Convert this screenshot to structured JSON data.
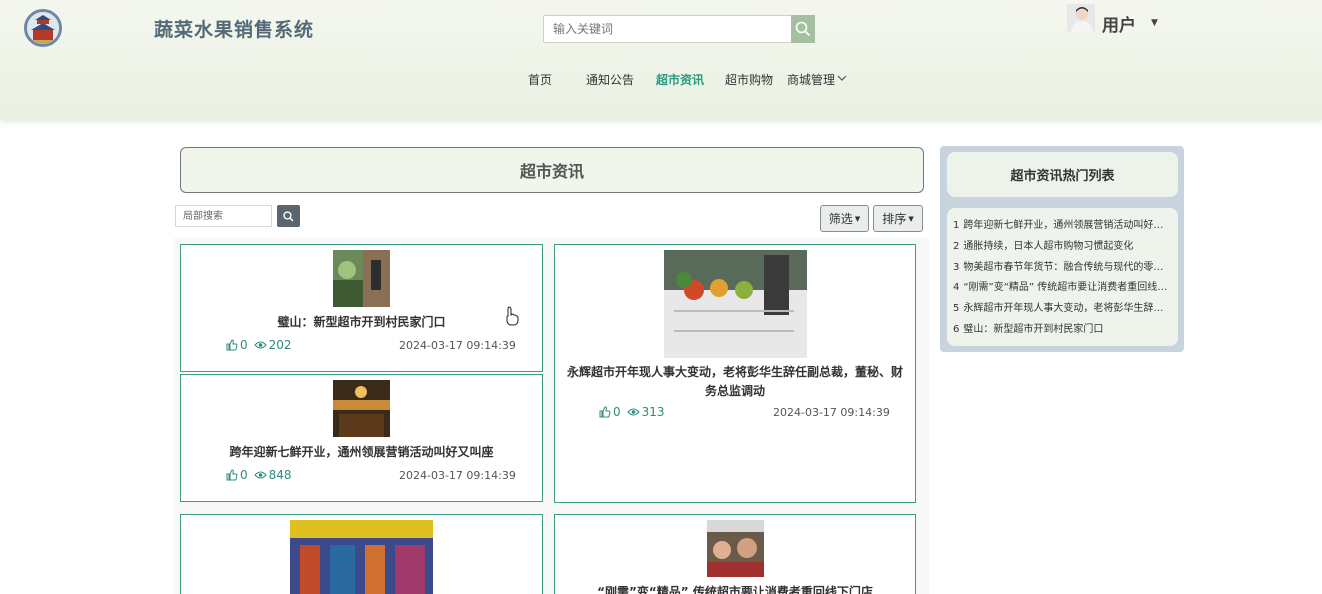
{
  "header": {
    "site_title": "蔬菜水果销售系统",
    "search_placeholder": "输入关键词",
    "user_label": "用户",
    "nav": [
      {
        "label": "首页",
        "active": false
      },
      {
        "label": "通知公告",
        "active": false
      },
      {
        "label": "超市资讯",
        "active": true
      },
      {
        "label": "超市购物",
        "active": false
      },
      {
        "label": "商城管理",
        "active": false,
        "has_dropdown": true
      }
    ],
    "accent_color": "#2a9a80"
  },
  "main": {
    "section_title": "超市资讯",
    "local_search_placeholder": "局部搜索",
    "filter_label": "筛选",
    "sort_label": "排序",
    "articles": [
      {
        "title": "璧山：新型超市开到村民家门口",
        "likes": "0",
        "views": "202",
        "date": "2024-03-17 09:14:39"
      },
      {
        "title": "跨年迎新七鲜开业，通州领展营销活动叫好又叫座",
        "likes": "0",
        "views": "848",
        "date": "2024-03-17 09:14:39"
      },
      {
        "title": "永辉超市开年现人事大变动，老将彭华生辞任副总裁，董秘、财务总监调动",
        "likes": "0",
        "views": "313",
        "date": "2024-03-17 09:14:39"
      },
      {
        "title": "",
        "likes": "",
        "views": "",
        "date": ""
      },
      {
        "title": "“刚需”变“精品” 传统超市要让消费者重回线下门店",
        "likes": "",
        "views": "",
        "date": ""
      }
    ]
  },
  "sidebar": {
    "title": "超市资讯热门列表",
    "items": [
      {
        "rank": "1",
        "text": "跨年迎新七鲜开业，通州领展营销活动叫好又叫座"
      },
      {
        "rank": "2",
        "text": "通胀持续，日本人超市购物习惯起变化"
      },
      {
        "rank": "3",
        "text": "物美超市春节年货节：融合传统与现代的零售新体验"
      },
      {
        "rank": "4",
        "text": "“刚需”变“精品” 传统超市要让消费者重回线下门店"
      },
      {
        "rank": "5",
        "text": "永辉超市开年现人事大变动，老将彭华生辞任副总裁"
      },
      {
        "rank": "6",
        "text": "璧山：新型超市开到村民家门口"
      }
    ]
  }
}
